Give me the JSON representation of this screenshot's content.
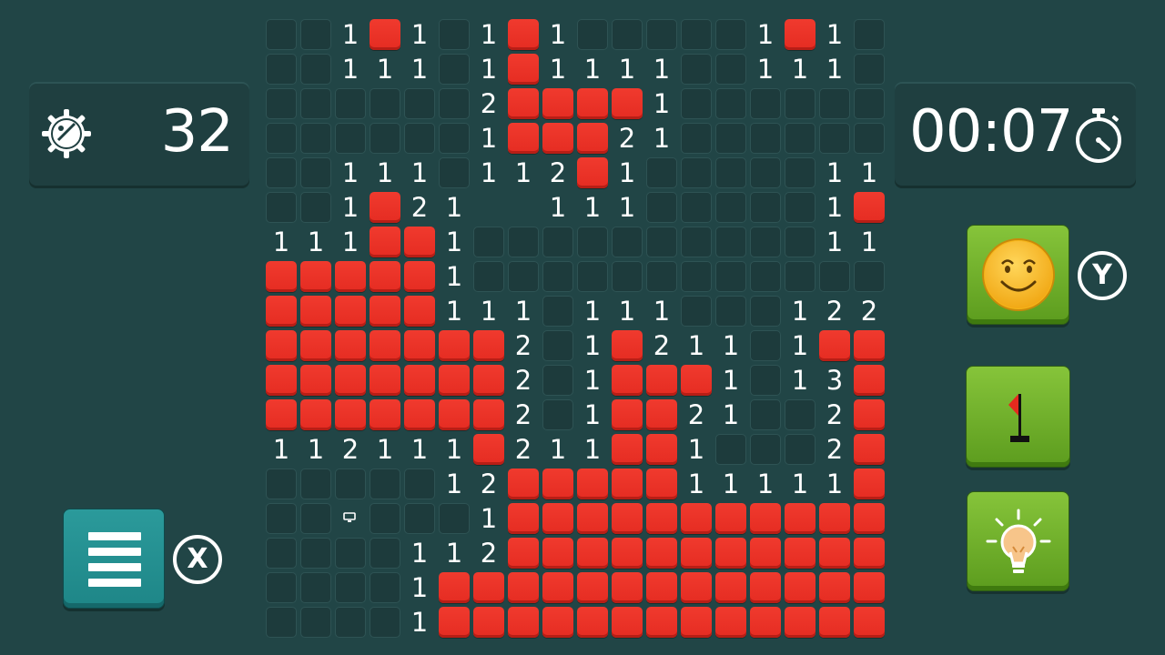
{
  "mine_counter": {
    "value": "32",
    "icon": "gear-mine-icon"
  },
  "timer": {
    "value": "00:07",
    "icon": "stopwatch-icon"
  },
  "buttons": {
    "new_game": {
      "icon": "smiley-icon",
      "key": "Y"
    },
    "flag_mode": {
      "icon": "flag-icon"
    },
    "hint": {
      "icon": "lightbulb-icon"
    },
    "menu": {
      "icon": "hamburger-icon",
      "key": "X"
    }
  },
  "colors": {
    "background": "#214546",
    "mine": "#e8332a",
    "button_green": "#74b42c",
    "button_teal": "#239192"
  },
  "board": {
    "legend": "H = hidden, M = mine, O = open empty, digit = adjacent count, P = marked",
    "rows": [
      "HH1M1H1M1HHHHH1M1H",
      "HH111H1M1111HH111H",
      "HHHHHH2MMMM1HHHHHH",
      "HHHHHH1MMM21HHHHHH",
      "HH111H112M1HHHHH11",
      "HH1M21OO111HHHHH1M",
      "111MM1HHHHHHHHHH11",
      "MMMMM1HHHHHHHHHHHH",
      "MMMMM111H111HHH122",
      "MMMMMMM2H1M211H1MM",
      "MMMMMMM2H1MMM1H13M",
      "MMMMMMM2H1MM21HH2M",
      "112111M211MM1HHH2M",
      "HHHHH12MMMMM11111M",
      "HHPHHH1MMMMMMMMMMM",
      "HHHH112MMMMMMMMMMM",
      "HHHH1MMMMMMMMMMMMM",
      "HHHH1MMMMMMMMMMMMM"
    ]
  }
}
